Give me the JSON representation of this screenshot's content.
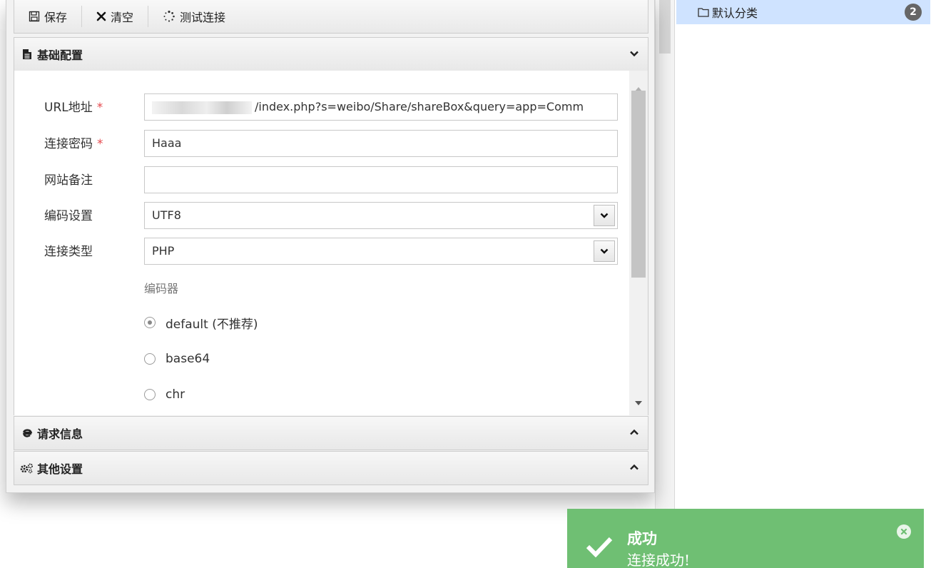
{
  "toolbar": {
    "save_label": "保存",
    "clear_label": "清空",
    "test_label": "测试连接"
  },
  "sections": {
    "basic": {
      "title": "基础配置",
      "state": "expanded"
    },
    "request": {
      "title": "请求信息",
      "state": "collapsed"
    },
    "other": {
      "title": "其他设置",
      "state": "collapsed"
    }
  },
  "form": {
    "url": {
      "label": "URL地址",
      "required_mark": "*",
      "value": "/index.php?s=weibo/Share/shareBox&query=app=Comm"
    },
    "password": {
      "label": "连接密码",
      "required_mark": "*",
      "value": "Haaa"
    },
    "note": {
      "label": "网站备注",
      "value": ""
    },
    "encoding": {
      "label": "编码设置",
      "value": "UTF8"
    },
    "type": {
      "label": "连接类型",
      "value": "PHP"
    },
    "encoder": {
      "label": "编码器",
      "options": [
        "default (不推荐)",
        "base64",
        "chr"
      ],
      "selected": "default (不推荐)"
    }
  },
  "category": {
    "label": "默认分类",
    "count": "2"
  },
  "toast": {
    "title": "成功",
    "message": "连接成功!"
  },
  "colors": {
    "selected_row": "#cfe3ff",
    "toast_bg": "#6fbf73",
    "required": "#e5484d",
    "badge": "#666666"
  }
}
